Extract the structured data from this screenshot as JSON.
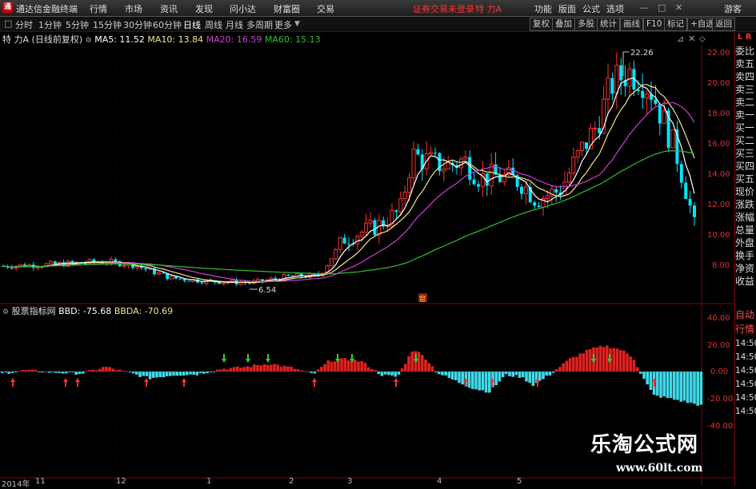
{
  "menubar": {
    "logo": "通",
    "title": "通达信金融终端",
    "items": [
      "行情",
      "市场",
      "资讯",
      "发现",
      "问小达",
      "财富圈",
      "交易"
    ],
    "alert": "证券交易未登录",
    "stock": "特 力A",
    "right_items": [
      "功能",
      "版面",
      "公式",
      "选项"
    ],
    "guest": "游客"
  },
  "toolbar": {
    "periods": [
      "分时",
      "1分钟",
      "5分钟",
      "15分钟",
      "30分钟",
      "60分钟",
      "日线",
      "周线",
      "月线",
      "多周期",
      "更多"
    ],
    "active": "日线",
    "buttons": [
      "复权",
      "叠加",
      "多股",
      "统计",
      "画线",
      "F10",
      "标记",
      "+自选",
      "返回"
    ]
  },
  "info": {
    "name": "特 力A",
    "adj": "(日线前复权)",
    "ma5": "MA5: 11.52",
    "ma10": "MA10: 13.84",
    "ma20": "MA20: 16.59",
    "ma60": "MA60: 15.13"
  },
  "indicator": {
    "name": "股票指标网",
    "bbd": "BBD: -75.68",
    "bbda": "BBDA: -70.69"
  },
  "sidepanel": {
    "header": "L R",
    "items": [
      "委比",
      "卖五",
      "卖四",
      "卖三",
      "卖二",
      "卖一",
      "买一",
      "买二",
      "买三",
      "买四",
      "买五",
      "现价",
      "涨跌",
      "涨幅",
      "总量",
      "外盘",
      "换手",
      "净资",
      "收益"
    ],
    "lower": [
      "自动",
      "行情",
      "14:50",
      "14:50",
      "14:50",
      "14:50",
      "14:50",
      "14:50"
    ]
  },
  "price_scale": [
    "22.00",
    "20.00",
    "18.00",
    "16.00",
    "14.00",
    "12.00",
    "10.00",
    "8.00"
  ],
  "ind_scale": [
    "40.00",
    "20.00",
    "0.00",
    "-20.00",
    "-40.00"
  ],
  "annotations": {
    "high": "22.26",
    "low": "6.54",
    "marker": "窗"
  },
  "time_axis": [
    "2014年",
    "11",
    "12",
    "1",
    "2",
    "3",
    "4",
    "5"
  ],
  "colors": {
    "up": "#ff3030",
    "down": "#00e5ff",
    "ma5": "#ffffff",
    "ma10": "#f0e68c",
    "ma20": "#d040d0",
    "ma60": "#30c030",
    "bbd_pos": "#e02020",
    "bbd_neg": "#40d8e8",
    "arrow_up": "#ff3030",
    "arrow_down": "#30d030"
  },
  "watermark": {
    "cn": "乐淘公式网",
    "url": "www.60lt.com"
  }
}
